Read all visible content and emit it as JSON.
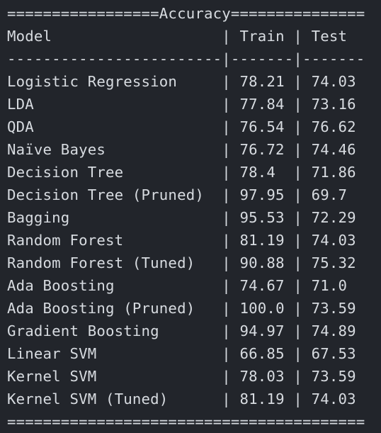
{
  "title_rule": "=================Accuracy===============",
  "columns": {
    "model": "Model",
    "train": "Train",
    "test": "Test"
  },
  "separator": "------------------------|-------|-------",
  "rows": [
    {
      "model": "Logistic Regression",
      "train": "78.21",
      "test": "74.03"
    },
    {
      "model": "LDA",
      "train": "77.84",
      "test": "73.16"
    },
    {
      "model": "QDA",
      "train": "76.54",
      "test": "76.62"
    },
    {
      "model": "Naïve Bayes",
      "train": "76.72",
      "test": "74.46"
    },
    {
      "model": "Decision Tree",
      "train": "78.4",
      "test": "71.86"
    },
    {
      "model": "Decision Tree (Pruned)",
      "train": "97.95",
      "test": "69.7"
    },
    {
      "model": "Bagging",
      "train": "95.53",
      "test": "72.29"
    },
    {
      "model": "Random Forest",
      "train": "81.19",
      "test": "74.03"
    },
    {
      "model": "Random Forest (Tuned)",
      "train": "90.88",
      "test": "75.32"
    },
    {
      "model": "Ada Boosting",
      "train": "74.67",
      "test": "71.0"
    },
    {
      "model": "Ada Boosting (Pruned)",
      "train": "100.0",
      "test": "73.59"
    },
    {
      "model": "Gradient Boosting",
      "train": "94.97",
      "test": "74.89"
    },
    {
      "model": "Linear SVM",
      "train": "66.85",
      "test": "67.53"
    },
    {
      "model": "Kernel SVM",
      "train": "78.03",
      "test": "73.59"
    },
    {
      "model": "Kernel SVM (Tuned)",
      "train": "81.19",
      "test": "74.03"
    }
  ],
  "bottom_rule": "========================================"
}
